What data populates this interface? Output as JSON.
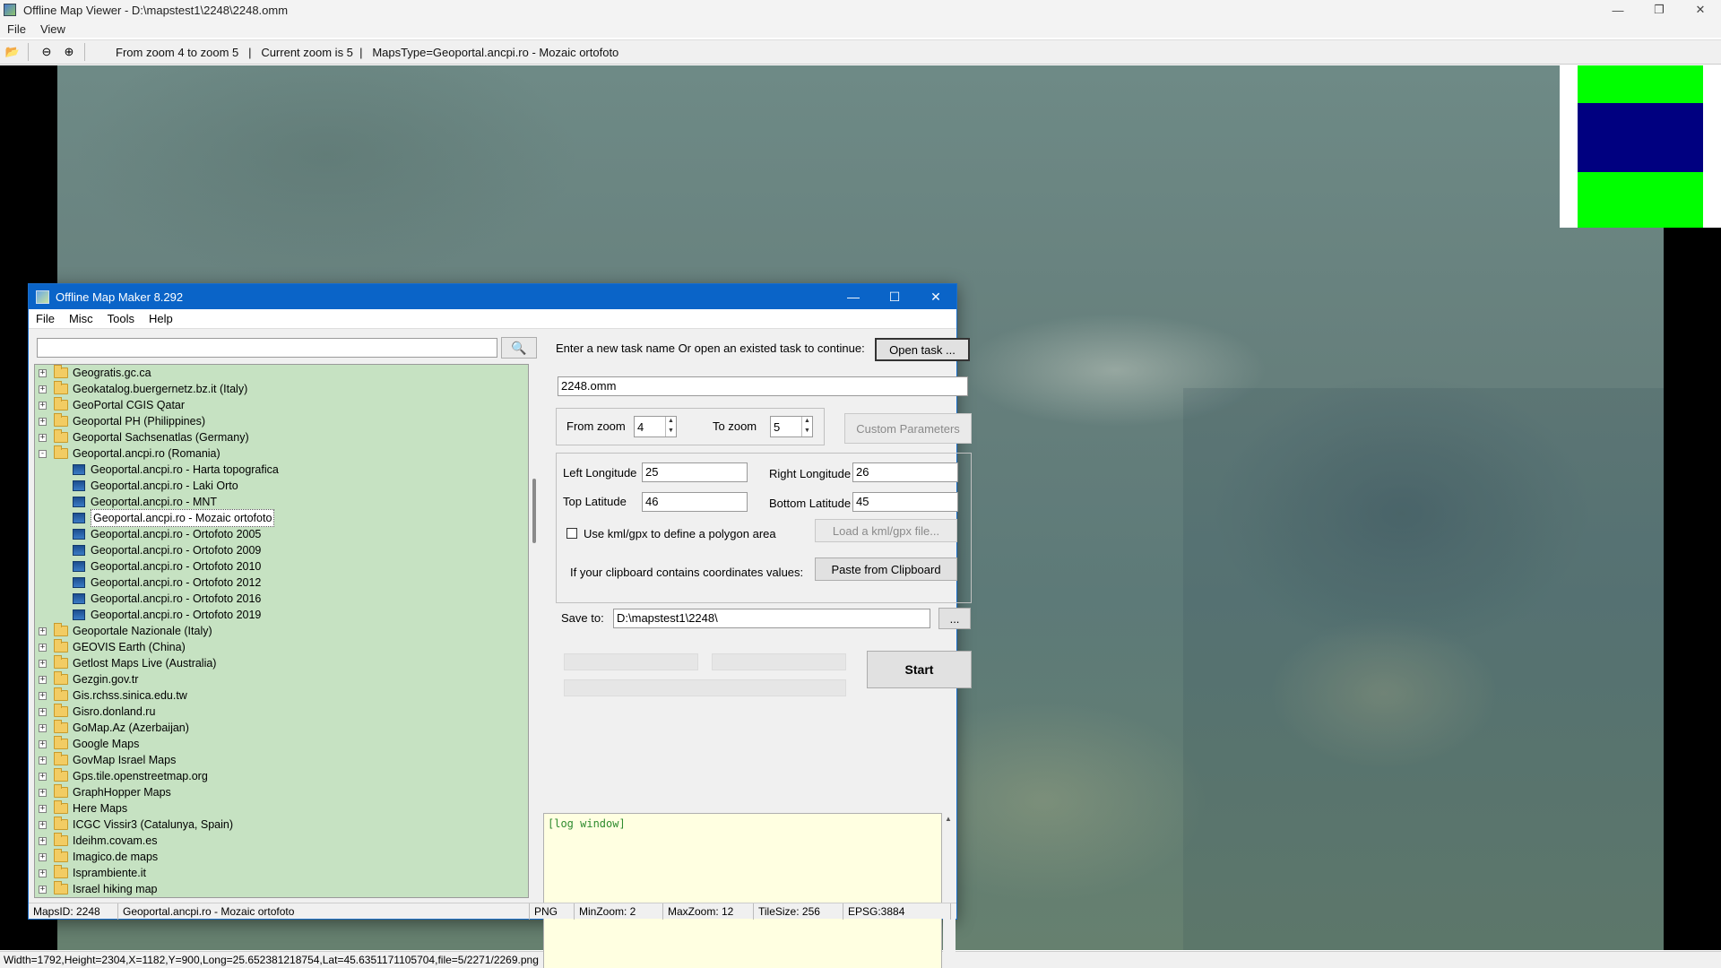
{
  "viewer": {
    "title": "Offline Map Viewer - D:\\mapstest1\\2248\\2248.omm",
    "menu": [
      "File",
      "View"
    ],
    "toolbar_status": "From zoom 4 to zoom 5   |   Current zoom is 5  |   MapsType=Geoportal.ancpi.ro - Mozaic ortofoto",
    "status_bar": "Width=1792,Height=2304,X=1182,Y=900,Long=25.652381218754,Lat=45.6351171105704,file=5/2271/2269.png",
    "overview_colors": {
      "top": "#00ff00",
      "middle": "#000080",
      "bottom": "#00ff00"
    }
  },
  "dialog": {
    "title": "Offline Map Maker 8.292",
    "menu": [
      "File",
      "Misc",
      "Tools",
      "Help"
    ],
    "search": {
      "value": "",
      "placeholder": ""
    },
    "tree": [
      {
        "label": "Geogratis.gc.ca",
        "type": "folder",
        "expander": "+"
      },
      {
        "label": "Geokatalog.buergernetz.bz.it (Italy)",
        "type": "folder",
        "expander": "+"
      },
      {
        "label": "GeoPortal CGIS Qatar",
        "type": "folder",
        "expander": "+"
      },
      {
        "label": "Geoportal PH (Philippines)",
        "type": "folder",
        "expander": "+"
      },
      {
        "label": "Geoportal Sachsenatlas (Germany)",
        "type": "folder",
        "expander": "+"
      },
      {
        "label": "Geoportal.ancpi.ro (Romania)",
        "type": "folder",
        "expander": "-"
      },
      {
        "label": "Geoportal.ancpi.ro - Harta topografica",
        "type": "leaf"
      },
      {
        "label": "Geoportal.ancpi.ro - Laki Orto",
        "type": "leaf"
      },
      {
        "label": "Geoportal.ancpi.ro - MNT",
        "type": "leaf"
      },
      {
        "label": "Geoportal.ancpi.ro - Mozaic ortofoto",
        "type": "leaf",
        "selected": true
      },
      {
        "label": "Geoportal.ancpi.ro - Ortofoto 2005",
        "type": "leaf"
      },
      {
        "label": "Geoportal.ancpi.ro - Ortofoto 2009",
        "type": "leaf"
      },
      {
        "label": "Geoportal.ancpi.ro - Ortofoto 2010",
        "type": "leaf"
      },
      {
        "label": "Geoportal.ancpi.ro - Ortofoto 2012",
        "type": "leaf"
      },
      {
        "label": "Geoportal.ancpi.ro - Ortofoto 2016",
        "type": "leaf"
      },
      {
        "label": "Geoportal.ancpi.ro - Ortofoto 2019",
        "type": "leaf"
      },
      {
        "label": "Geoportale Nazionale (Italy)",
        "type": "folder",
        "expander": "+"
      },
      {
        "label": "GEOVIS Earth (China)",
        "type": "folder",
        "expander": "+"
      },
      {
        "label": "Getlost Maps Live (Australia)",
        "type": "folder",
        "expander": "+"
      },
      {
        "label": "Gezgin.gov.tr",
        "type": "folder",
        "expander": "+"
      },
      {
        "label": "Gis.rchss.sinica.edu.tw",
        "type": "folder",
        "expander": "+"
      },
      {
        "label": "Gisro.donland.ru",
        "type": "folder",
        "expander": "+"
      },
      {
        "label": "GoMap.Az (Azerbaijan)",
        "type": "folder",
        "expander": "+"
      },
      {
        "label": "Google Maps",
        "type": "folder",
        "expander": "+"
      },
      {
        "label": "GovMap Israel Maps",
        "type": "folder",
        "expander": "+"
      },
      {
        "label": "Gps.tile.openstreetmap.org",
        "type": "folder",
        "expander": "+"
      },
      {
        "label": "GraphHopper Maps",
        "type": "folder",
        "expander": "+"
      },
      {
        "label": "Here Maps",
        "type": "folder",
        "expander": "+"
      },
      {
        "label": "ICGC Vissir3 (Catalunya, Spain)",
        "type": "folder",
        "expander": "+"
      },
      {
        "label": "Ideihm.covam.es",
        "type": "folder",
        "expander": "+"
      },
      {
        "label": "Imagico.de maps",
        "type": "folder",
        "expander": "+"
      },
      {
        "label": "Isprambiente.it",
        "type": "folder",
        "expander": "+"
      },
      {
        "label": "Israel hiking map",
        "type": "folder",
        "expander": "+"
      }
    ],
    "task_prompt": "Enter a new task name Or open an existed task to continue:",
    "open_task_label": "Open task ...",
    "task_name": "2248.omm",
    "from_zoom_label": "From zoom",
    "from_zoom": "4",
    "to_zoom_label": "To zoom",
    "to_zoom": "5",
    "custom_params_label": "Custom Parameters",
    "left_lon_label": "Left Longitude",
    "left_lon": "25",
    "right_lon_label": "Right Longitude",
    "right_lon": "26",
    "top_lat_label": "Top Latitude",
    "top_lat": "46",
    "bottom_lat_label": "Bottom Latitude",
    "bottom_lat": "45",
    "kml_label": "Use kml/gpx to define a polygon area",
    "load_kml_label": "Load a kml/gpx file...",
    "clipboard_prompt": "If your clipboard contains coordinates values:",
    "paste_label": "Paste from Clipboard",
    "save_to_label": "Save to:",
    "save_to": "D:\\mapstest1\\2248\\",
    "browse_label": "...",
    "start_label": "Start",
    "log_text": "[log window]",
    "status": {
      "maps_id": "MapsID: 2248",
      "maps_name": "Geoportal.ancpi.ro - Mozaic ortofoto",
      "format": "PNG",
      "min_zoom": "MinZoom: 2",
      "max_zoom": "MaxZoom: 12",
      "tile_size": "TileSize: 256",
      "epsg": "EPSG:3884"
    }
  }
}
